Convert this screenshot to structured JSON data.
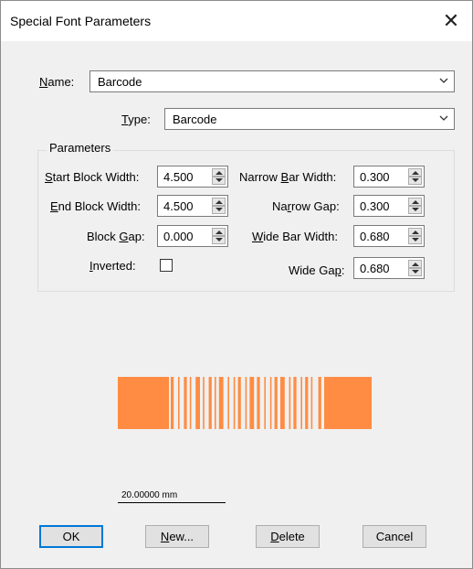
{
  "window": {
    "title": "Special Font Parameters"
  },
  "name": {
    "label_u": "N",
    "label_rest": "ame:",
    "value": "Barcode"
  },
  "type": {
    "label_u": "T",
    "label_rest": "ype:",
    "value": "Barcode"
  },
  "parameters": {
    "title": "Parameters",
    "start_block_width": {
      "u": "S",
      "rest": "tart Block Width:",
      "value": "4.500"
    },
    "end_block_width": {
      "u": "E",
      "rest": "nd Block Width:",
      "value": "4.500"
    },
    "block_gap": {
      "pre": "Block ",
      "u": "G",
      "post": "ap:",
      "value": "0.000"
    },
    "inverted": {
      "u": "I",
      "rest": "nverted:",
      "checked": false
    },
    "narrow_bar_width": {
      "pre": "Narrow ",
      "u": "B",
      "post": "ar Width:",
      "value": "0.300"
    },
    "narrow_gap": {
      "pre": "Na",
      "u": "r",
      "post": "row Gap:",
      "value": "0.300"
    },
    "wide_bar_width": {
      "pre": "",
      "u": "W",
      "post": "ide Bar Width:",
      "value": "0.680"
    },
    "wide_gap": {
      "pre": "Wide Ga",
      "u": "p",
      "post": ":",
      "value": "0.680"
    }
  },
  "preview": {
    "bar_color": "#ff8c42",
    "scale_label": "20.00000 mm"
  },
  "buttons": {
    "ok": "OK",
    "new_u": "N",
    "new_rest": "ew...",
    "delete_u": "D",
    "delete_rest": "elete",
    "cancel": "Cancel"
  },
  "icons": {
    "close": "close-icon",
    "dropdown": "chevron-down-icon",
    "spin_up": "spin-up-icon",
    "spin_down": "spin-down-icon"
  }
}
